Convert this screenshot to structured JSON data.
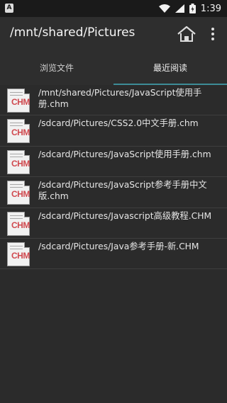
{
  "statusbar": {
    "badge": "A",
    "time": "1:39"
  },
  "appbar": {
    "title": "/mnt/shared/Pictures",
    "home_icon": "home-icon",
    "menu_icon": "more-vert-icon"
  },
  "tabs": [
    {
      "label": "浏览文件",
      "selected": false
    },
    {
      "label": "最近阅读",
      "selected": true
    }
  ],
  "accent_color": "#3d8c97",
  "files": [
    {
      "icon": "chm-file-icon",
      "icon_text": "CHM",
      "path": "/mnt/shared/Pictures/JavaScript使用手册.chm"
    },
    {
      "icon": "chm-file-icon",
      "icon_text": "CHM",
      "path": "/sdcard/Pictures/CSS2.0中文手册.chm"
    },
    {
      "icon": "chm-file-icon",
      "icon_text": "CHM",
      "path": "/sdcard/Pictures/JavaScript使用手册.chm"
    },
    {
      "icon": "chm-file-icon",
      "icon_text": "CHM",
      "path": "/sdcard/Pictures/JavaScript参考手册中文版.chm"
    },
    {
      "icon": "chm-file-icon",
      "icon_text": "CHM",
      "path": "/sdcard/Pictures/Javascript高级教程.CHM"
    },
    {
      "icon": "chm-file-icon",
      "icon_text": "CHM",
      "path": "/sdcard/Pictures/Java参考手册-新.CHM"
    }
  ]
}
